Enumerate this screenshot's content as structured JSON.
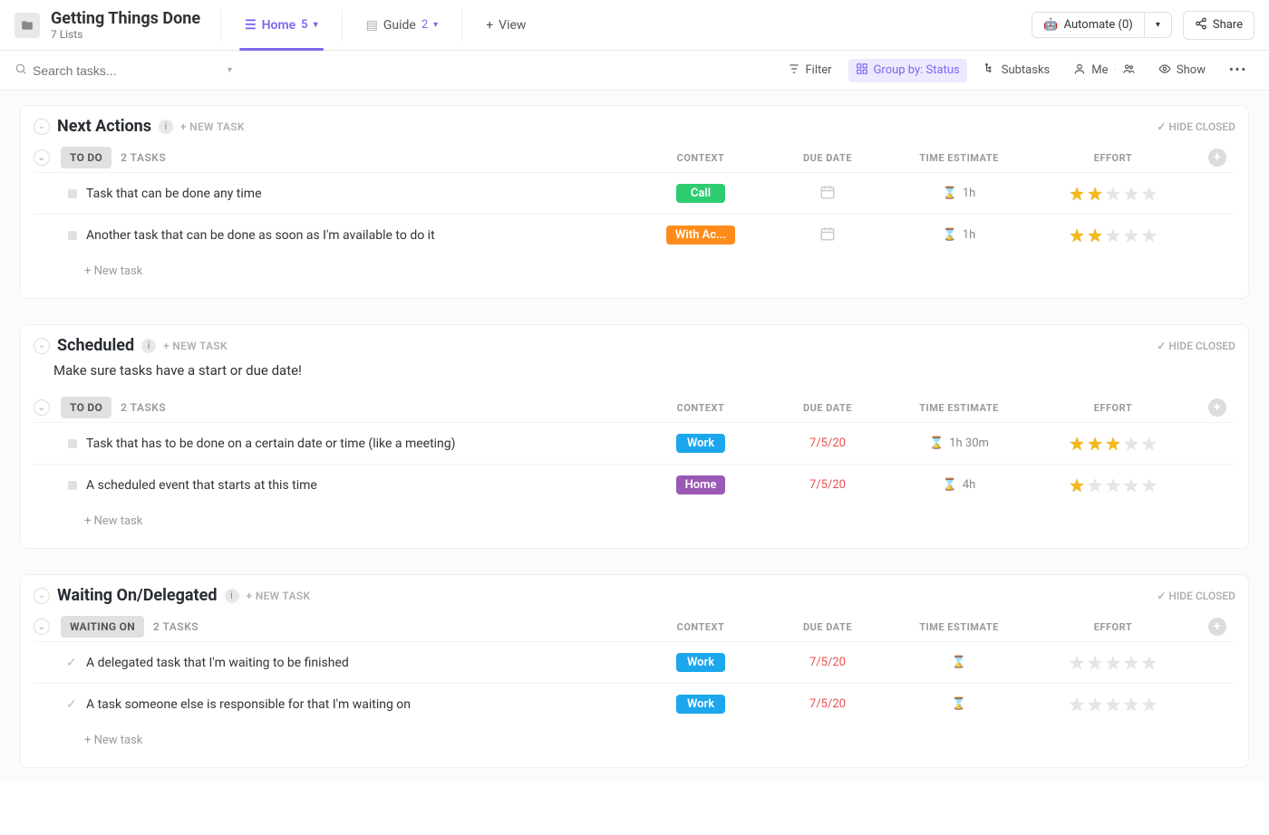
{
  "header": {
    "title": "Getting Things Done",
    "subtitle": "7 Lists",
    "views": [
      {
        "label": "Home",
        "count": "5",
        "active": true,
        "icon": "list-icon"
      },
      {
        "label": "Guide",
        "count": "2",
        "active": false,
        "icon": "doc-icon"
      }
    ],
    "add_view_label": "View",
    "automate_label": "Automate (0)",
    "share_label": "Share"
  },
  "toolbar": {
    "search_placeholder": "Search tasks...",
    "filter_label": "Filter",
    "group_by_label": "Group by: Status",
    "subtasks_label": "Subtasks",
    "me_label": "Me",
    "show_label": "Show"
  },
  "column_headers": {
    "context": "CONTEXT",
    "due": "DUE DATE",
    "estimate": "TIME ESTIMATE",
    "effort": "EFFORT"
  },
  "common": {
    "hide_closed": "HIDE CLOSED",
    "new_task_upper": "+ NEW TASK",
    "new_task_lower": "+ New task",
    "check": "✓"
  },
  "context_colors": {
    "Call": "#2ecc71",
    "With Ac...": "#ff8c1a",
    "Work": "#1ca7ec",
    "Home": "#9b59b6"
  },
  "sections": [
    {
      "title": "Next Actions",
      "description": "",
      "groups": [
        {
          "status_label": "TO DO",
          "count_label": "2 TASKS",
          "status_kind": "todo",
          "tasks": [
            {
              "name": "Task that can be done any time",
              "context": "Call",
              "due": "",
              "estimate": "1h",
              "effort": 2
            },
            {
              "name": "Another task that can be done as soon as I'm available to do it",
              "context": "With Ac...",
              "due": "",
              "estimate": "1h",
              "effort": 2
            }
          ]
        }
      ]
    },
    {
      "title": "Scheduled",
      "description": "Make sure tasks have a start or due date!",
      "groups": [
        {
          "status_label": "TO DO",
          "count_label": "2 TASKS",
          "status_kind": "todo",
          "tasks": [
            {
              "name": "Task that has to be done on a certain date or time (like a meeting)",
              "context": "Work",
              "due": "7/5/20",
              "estimate": "1h 30m",
              "effort": 3
            },
            {
              "name": "A scheduled event that starts at this time",
              "context": "Home",
              "due": "7/5/20",
              "estimate": "4h",
              "effort": 1
            }
          ]
        }
      ]
    },
    {
      "title": "Waiting On/Delegated",
      "description": "",
      "groups": [
        {
          "status_label": "WAITING ON",
          "count_label": "2 TASKS",
          "status_kind": "waiting",
          "tasks": [
            {
              "name": "A delegated task that I'm waiting to be finished",
              "context": "Work",
              "due": "7/5/20",
              "estimate": "",
              "effort": 0
            },
            {
              "name": "A task someone else is responsible for that I'm waiting on",
              "context": "Work",
              "due": "7/5/20",
              "estimate": "",
              "effort": 0
            }
          ]
        }
      ]
    }
  ]
}
